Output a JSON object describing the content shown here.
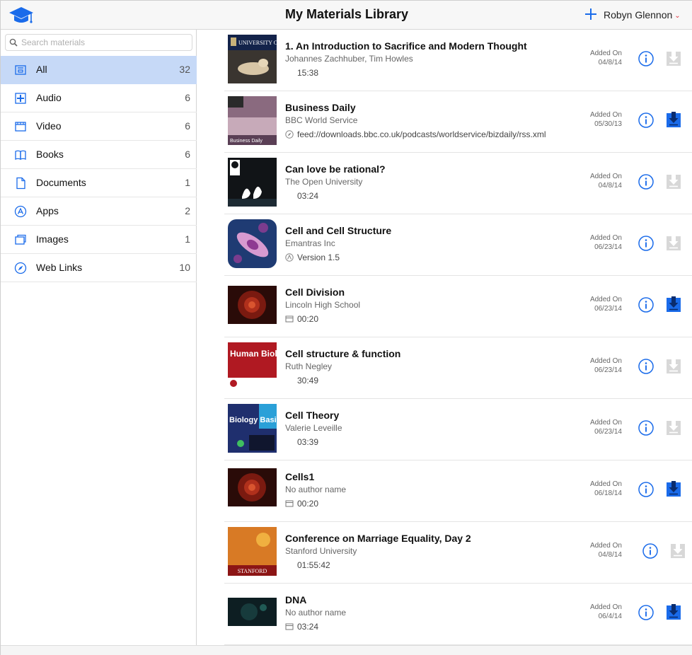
{
  "header": {
    "title": "My Materials Library",
    "user_name": "Robyn Glennon",
    "user_chevron": "⌄",
    "logo_icon": "graduation-cap-icon",
    "add_icon": "plus-icon",
    "accent_color": "#1a6bea"
  },
  "search": {
    "placeholder": "Search materials",
    "value": ""
  },
  "sidebar": {
    "selected_color": "#c6d9f7",
    "items": [
      {
        "label": "All",
        "count": "32",
        "icon": "all-materials-icon"
      },
      {
        "label": "Audio",
        "count": "6",
        "icon": "audio-icon"
      },
      {
        "label": "Video",
        "count": "6",
        "icon": "video-icon"
      },
      {
        "label": "Books",
        "count": "6",
        "icon": "book-icon"
      },
      {
        "label": "Documents",
        "count": "1",
        "icon": "document-icon"
      },
      {
        "label": "Apps",
        "count": "2",
        "icon": "app-icon"
      },
      {
        "label": "Images",
        "count": "1",
        "icon": "images-icon"
      },
      {
        "label": "Web Links",
        "count": "10",
        "icon": "web-link-icon"
      }
    ]
  },
  "materials": [
    {
      "title": "1. An Introduction to Sacrifice and Modern Thought",
      "author": "Johannes Zachhuber, Tim Howles",
      "meta": "15:38",
      "meta_icon": "",
      "added_label": "Added On",
      "added_date": "04/8/14",
      "downloaded": false,
      "thumb_text": "UNIVERSITY OF OXFORD"
    },
    {
      "title": "Business Daily",
      "author": "BBC World Service",
      "meta": "feed://downloads.bbc.co.uk/podcasts/worldservice/bizdaily/rss.xml",
      "meta_icon": "feed-icon",
      "added_label": "Added On",
      "added_date": "05/30/13",
      "downloaded": true,
      "thumb_text": "Business Daily"
    },
    {
      "title": "Can love be rational?",
      "author": "The Open University",
      "meta": "03:24",
      "meta_icon": "",
      "added_label": "Added On",
      "added_date": "04/8/14",
      "downloaded": false,
      "thumb_text": ""
    },
    {
      "title": "Cell and Cell Structure",
      "author": "Emantras Inc",
      "meta": "Version 1.5",
      "meta_icon": "app-icon",
      "added_label": "Added On",
      "added_date": "06/23/14",
      "downloaded": false,
      "thumb_text": ""
    },
    {
      "title": "Cell Division",
      "author": "Lincoln High School",
      "meta": "00:20",
      "meta_icon": "video-icon",
      "added_label": "Added On",
      "added_date": "06/23/14",
      "downloaded": true,
      "thumb_text": ""
    },
    {
      "title": "Cell structure & function",
      "author": "Ruth Negley",
      "meta": "30:49",
      "meta_icon": "",
      "added_label": "Added On",
      "added_date": "06/23/14",
      "downloaded": false,
      "thumb_text": "Human Biology"
    },
    {
      "title": "Cell Theory",
      "author": "Valerie Leveille",
      "meta": "03:39",
      "meta_icon": "",
      "added_label": "Added On",
      "added_date": "06/23/14",
      "downloaded": false,
      "thumb_text": "Biology Basics"
    },
    {
      "title": "Cells1",
      "author": "No author name",
      "meta": "00:20",
      "meta_icon": "video-icon",
      "added_label": "Added On",
      "added_date": "06/18/14",
      "downloaded": true,
      "thumb_text": ""
    },
    {
      "title": "Conference on Marriage Equality, Day 2",
      "author": "Stanford University",
      "meta": "01:55:42",
      "meta_icon": "",
      "added_label": "Added On",
      "added_date": "04/8/14",
      "downloaded": false,
      "thumb_text": "STANFORD"
    },
    {
      "title": "DNA",
      "author": "No author name",
      "meta": "03:24",
      "meta_icon": "video-icon",
      "added_label": "Added On",
      "added_date": "06/4/14",
      "downloaded": true,
      "thumb_text": ""
    }
  ]
}
